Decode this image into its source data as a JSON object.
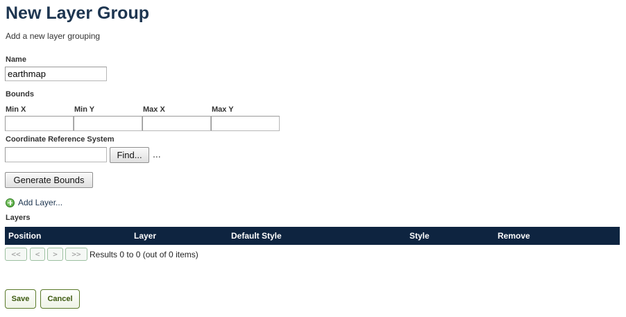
{
  "page": {
    "title": "New Layer Group",
    "subtitle": "Add a new layer grouping"
  },
  "name": {
    "label": "Name",
    "value": "earthmap"
  },
  "bounds": {
    "label": "Bounds",
    "min_x_label": "Min X",
    "min_y_label": "Min Y",
    "max_x_label": "Max X",
    "max_y_label": "Max Y",
    "min_x": "",
    "min_y": "",
    "max_x": "",
    "max_y": ""
  },
  "crs": {
    "label": "Coordinate Reference System",
    "value": "",
    "find_label": "Find...",
    "ellipsis": "..."
  },
  "generate_bounds_label": "Generate Bounds",
  "add_layer": {
    "label": "Add Layer...",
    "icon": "add-icon",
    "icon_color": "#3f9b2c"
  },
  "layers": {
    "label": "Layers",
    "columns": [
      "Position",
      "Layer",
      "Default Style",
      "Style",
      "Remove"
    ],
    "header_color": "#0e2440"
  },
  "pager": {
    "first": "<<",
    "prev": "<",
    "next": ">",
    "last": ">>",
    "info": "Results 0 to 0 (out of 0 items)"
  },
  "actions": {
    "save": "Save",
    "cancel": "Cancel"
  }
}
